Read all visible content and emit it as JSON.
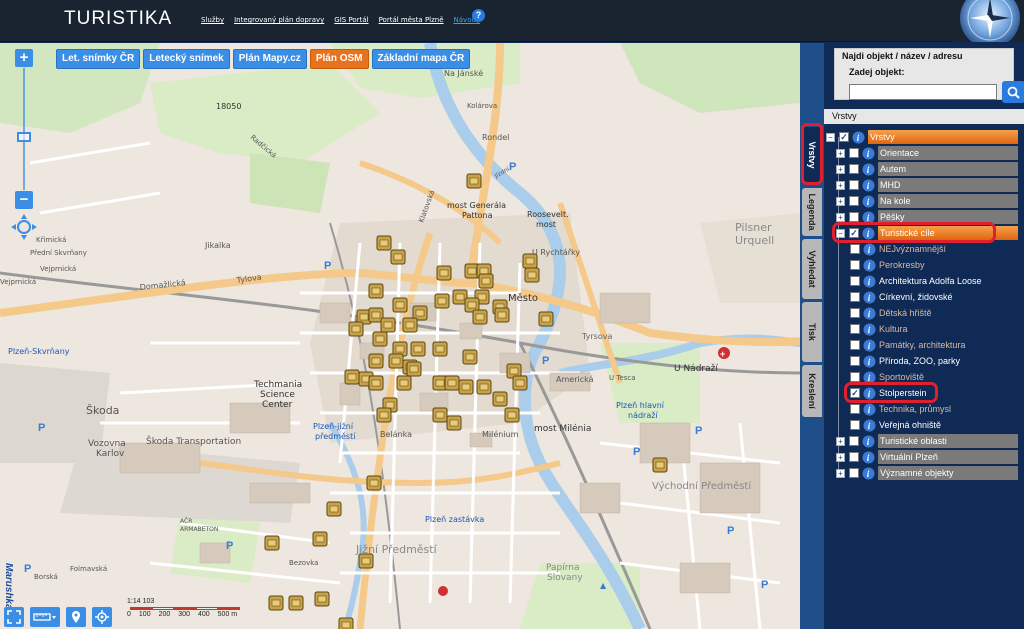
{
  "header": {
    "title": "TURISTIKA",
    "links": [
      "Služby",
      "Integrovaný plán dopravy",
      "GIS Portál",
      "Portál města Plzně",
      "Návody"
    ],
    "help": "?"
  },
  "map": {
    "basemap_buttons": [
      {
        "label": "Let. snímky ČR",
        "active": false
      },
      {
        "label": "Letecký snímek",
        "active": false
      },
      {
        "label": "Plán Mapy.cz",
        "active": false
      },
      {
        "label": "Plán OSM",
        "active": true
      },
      {
        "label": "Základní mapa ČR",
        "active": false
      }
    ],
    "zoom_in": "+",
    "zoom_out": "−",
    "brand": "Marushka®",
    "scale": {
      "ratio": "1:14 103",
      "ticks": [
        "0",
        "100",
        "200",
        "300",
        "400",
        "500 m"
      ]
    },
    "labels": [
      "Na Jánské",
      "Kolárova",
      "Rondel",
      "most Generála Pattona",
      "Roosevelt. most",
      "U Rychtářky",
      "Americká",
      "Jízdní",
      "U Trati",
      "Pilsner Urquell",
      "Plzeň-Skvrňany",
      "Plzeň-jižní předměstí",
      "Plzeň hlavní nádraží",
      "U Nádraží",
      "most Milénia",
      "Škoda",
      "Vozovna Karlov",
      "Škoda Transportation",
      "Techmania Science Center",
      "Plzeň zastávka",
      "Jižní Předměstí",
      "Papírna Slovany",
      "Východní Předměstí",
      "Domažlická",
      "Tylova",
      "Klatovská",
      "Borská",
      "Folmavská",
      "Bezovka",
      "Křimická",
      "Přední Skvrňany",
      "Vejprnická",
      "Radčická",
      "18050",
      "AČR ARMABETON",
      "Belánka",
      "Milénium",
      "U Tesca",
      "Tyrsova"
    ],
    "poi_count": 60
  },
  "side_tabs": [
    "Vrstvy",
    "Legenda",
    "Vyhledat",
    "Tisk",
    "Kreslení"
  ],
  "search": {
    "title": "Najdi objekt / název / adresu",
    "label": "Zadej objekt:",
    "value": ""
  },
  "layers": {
    "header": "Vrstvy",
    "root": "Vrstvy",
    "items": [
      {
        "label": "Orientace",
        "checked": false
      },
      {
        "label": "Autem",
        "checked": false
      },
      {
        "label": "MHD",
        "checked": false
      },
      {
        "label": "Na kole",
        "checked": false
      },
      {
        "label": "Pěšky",
        "checked": false
      },
      {
        "label": "Turistické cíle",
        "checked": true,
        "expanded": true
      }
    ],
    "sub_items": [
      {
        "label": "NEJvýznamnější",
        "checked": false,
        "dim": true
      },
      {
        "label": "Perokresby",
        "checked": false,
        "dim": true
      },
      {
        "label": "Architektura Adolfa Loose",
        "checked": false,
        "dim": false
      },
      {
        "label": "Církevní, židovské",
        "checked": false,
        "dim": false
      },
      {
        "label": "Dětská hřiště",
        "checked": false,
        "dim": true
      },
      {
        "label": "Kultura",
        "checked": false,
        "dim": true
      },
      {
        "label": "Památky, architektura",
        "checked": false,
        "dim": true
      },
      {
        "label": "Příroda, ZOO, parky",
        "checked": false,
        "dim": false
      },
      {
        "label": "Sportoviště",
        "checked": false,
        "dim": true
      },
      {
        "label": "Stolperstein",
        "checked": true,
        "dim": false
      },
      {
        "label": "Technika, průmysl",
        "checked": false,
        "dim": true
      },
      {
        "label": "Veřejná ohniště",
        "checked": false,
        "dim": false
      }
    ],
    "tail_items": [
      {
        "label": "Turistické oblasti",
        "checked": false
      },
      {
        "label": "Virtuální Plzeň",
        "checked": false
      },
      {
        "label": "Významné objekty",
        "checked": false
      }
    ]
  }
}
